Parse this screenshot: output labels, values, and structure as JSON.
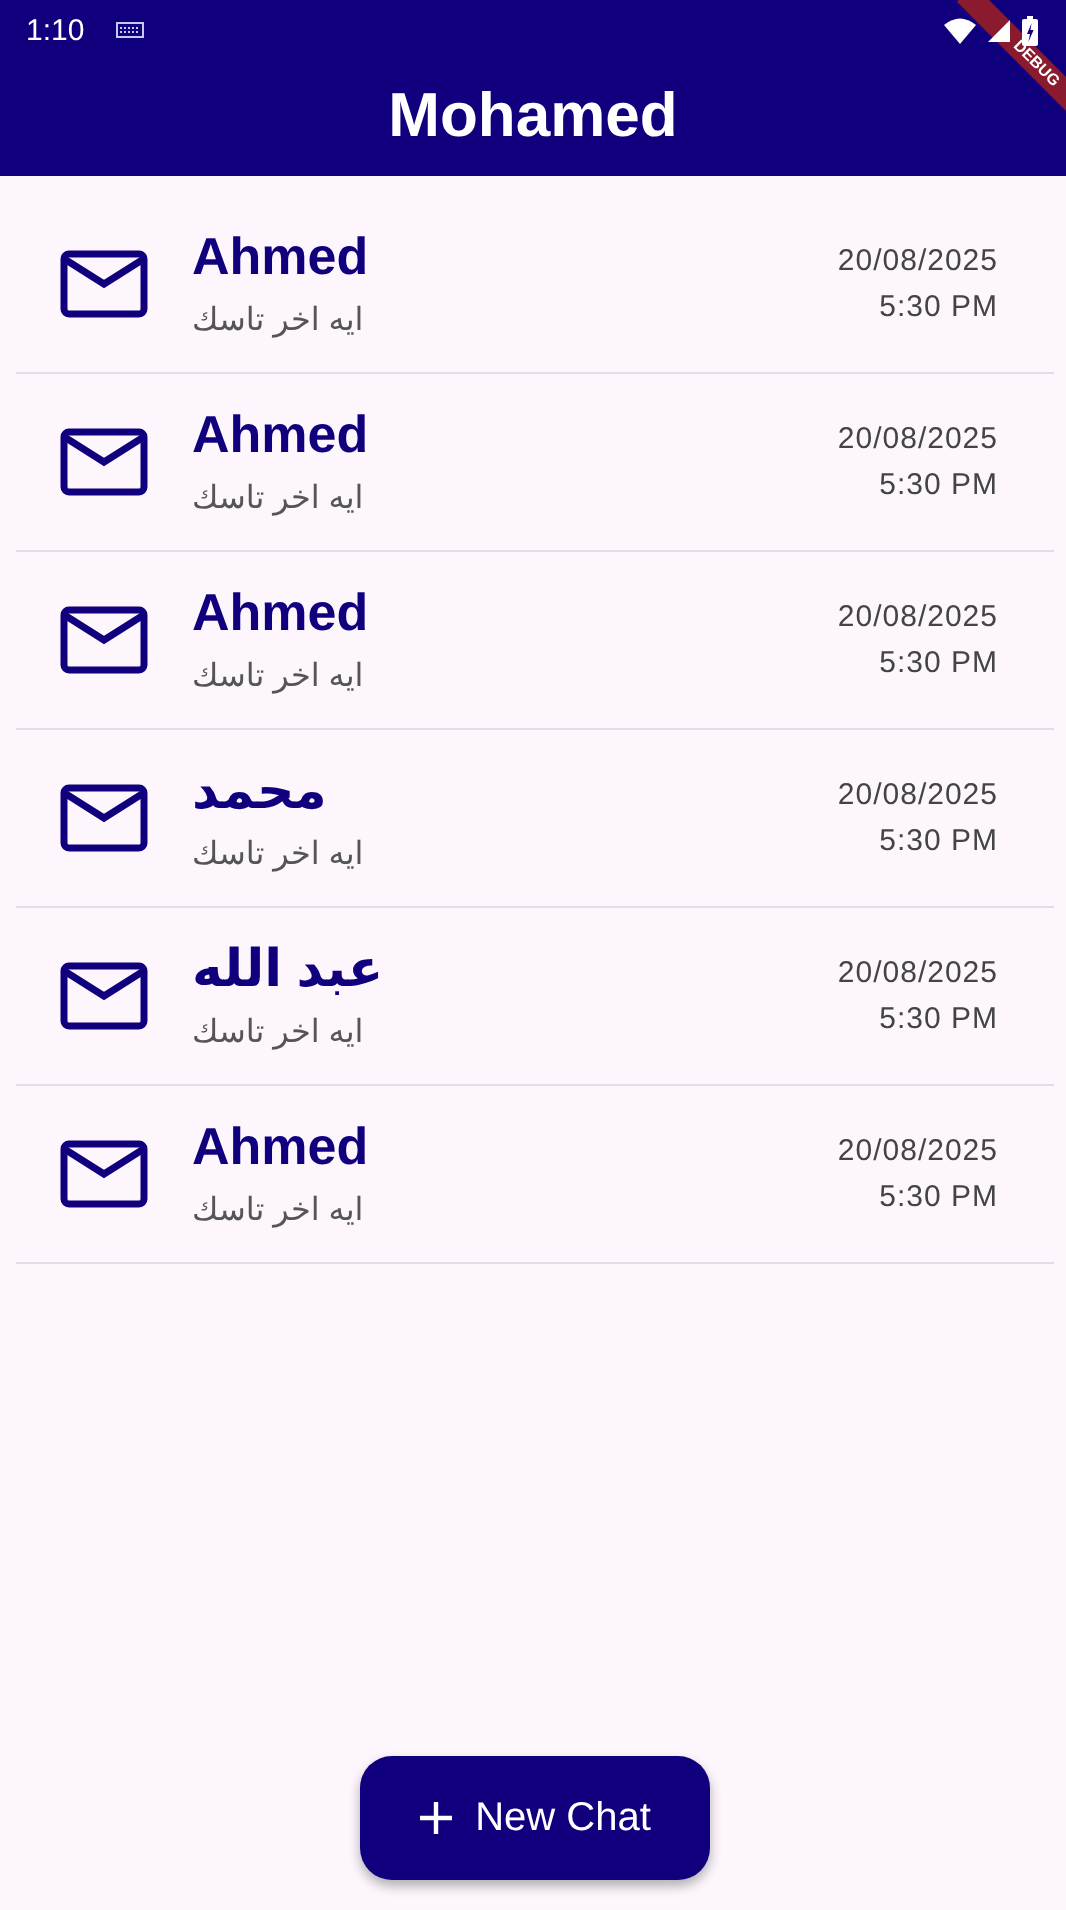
{
  "status_bar": {
    "time": "1:10"
  },
  "debug_banner": "DEBUG",
  "app_bar": {
    "title": "Mohamed"
  },
  "chats": [
    {
      "name": "Ahmed",
      "message": "ايه اخر تاسك",
      "date": "20/08/2025",
      "time": "5:30 PM"
    },
    {
      "name": "Ahmed",
      "message": "ايه اخر تاسك",
      "date": "20/08/2025",
      "time": "5:30 PM"
    },
    {
      "name": "Ahmed",
      "message": "ايه اخر تاسك",
      "date": "20/08/2025",
      "time": "5:30 PM"
    },
    {
      "name": "محمد",
      "message": "ايه اخر تاسك",
      "date": "20/08/2025",
      "time": "5:30 PM"
    },
    {
      "name": "عبد الله",
      "message": "ايه اخر تاسك",
      "date": "20/08/2025",
      "time": "5:30 PM"
    },
    {
      "name": "Ahmed",
      "message": "ايه اخر تاسك",
      "date": "20/08/2025",
      "time": "5:30 PM"
    }
  ],
  "fab": {
    "label": "New Chat"
  }
}
